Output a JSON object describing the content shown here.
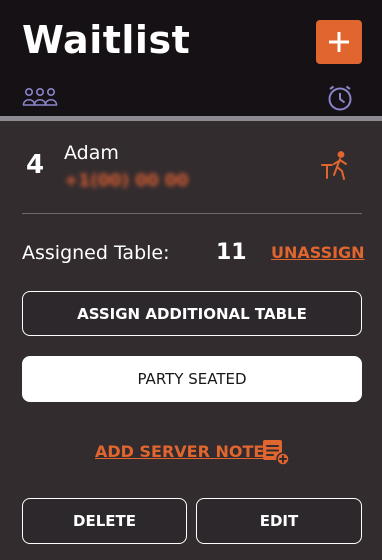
{
  "header": {
    "title": "Waitlist",
    "add_button_icon": "plus-icon",
    "tabs": [
      {
        "icon": "guests-icon",
        "active": false
      },
      {
        "icon": "clock-icon",
        "active": true
      }
    ]
  },
  "guest": {
    "party_size": "4",
    "name": "Adam",
    "phone": "+1(00) 00 00",
    "status_icon": "table-walk-in-icon"
  },
  "assignment": {
    "label": "Assigned Table:",
    "table": "11",
    "unassign_label": "UNASSIGN"
  },
  "actions": {
    "assign_additional": "ASSIGN ADDITIONAL TABLE",
    "party_seated": "PARTY SEATED",
    "add_note": "ADD SERVER NOTE",
    "add_note_icon": "note-add-icon",
    "delete": "DELETE",
    "edit": "EDIT"
  },
  "colors": {
    "accent": "#e0652f",
    "header_bg": "#151114",
    "panel_bg": "#322c2f",
    "tab_icon": "#8a84c9"
  }
}
